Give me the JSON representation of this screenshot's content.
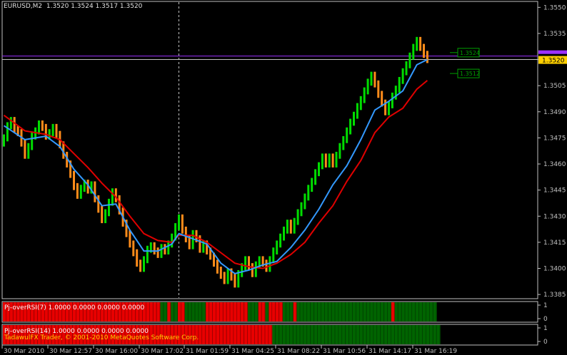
{
  "header": {
    "symbol_text": "EURUSD,M2",
    "ohlc_text": "1.3520 1.3524 1.3517 1.3520"
  },
  "colors": {
    "background": "#000000",
    "frame": "#c0c0c0",
    "bull": "#00dd00",
    "bear": "#ff8c1a",
    "ma_fast": "#3399ff",
    "ma_slow": "#e00000",
    "bid_line": "#9b30ff",
    "ask_box": "#ffd000",
    "indicator_red": "#e80000",
    "indicator_green": "#006400",
    "level_box": "#00a000"
  },
  "chart_data": [
    {
      "type": "candlestick",
      "name": "EURUSD,M2",
      "ylim": [
        1.3383,
        1.3553
      ],
      "y_ticks": [
        "1.3550",
        "1.3535",
        "1.3520",
        "1.3505",
        "1.3490",
        "1.3475",
        "1.3460",
        "1.3445",
        "1.3430",
        "1.3415",
        "1.3400",
        "1.3385"
      ],
      "x_ticks": [
        "30 Mar 2010",
        "30 Mar 12:57",
        "30 Mar 16:00",
        "30 Mar 17:02",
        "31 Mar 01:59",
        "31 Mar 04:25",
        "31 Mar 08:22",
        "31 Mar 10:56",
        "31 Mar 14:17",
        "31 Mar 16:19"
      ],
      "close": [
        1.3475,
        1.3482,
        1.3485,
        1.348,
        1.3478,
        1.3472,
        1.3465,
        1.347,
        1.3476,
        1.3479,
        1.3483,
        1.3481,
        1.3476,
        1.3478,
        1.3481,
        1.3477,
        1.3471,
        1.3465,
        1.346,
        1.3454,
        1.3447,
        1.3442,
        1.3446,
        1.3449,
        1.3445,
        1.3448,
        1.344,
        1.3434,
        1.3428,
        1.3432,
        1.3438,
        1.3444,
        1.344,
        1.3433,
        1.3426,
        1.342,
        1.3414,
        1.3409,
        1.3403,
        1.34,
        1.3405,
        1.3411,
        1.3413,
        1.341,
        1.3408,
        1.3412,
        1.341,
        1.3414,
        1.3418,
        1.3424,
        1.3429,
        1.3422,
        1.3417,
        1.3413,
        1.342,
        1.3417,
        1.3411,
        1.3414,
        1.341,
        1.3407,
        1.3403,
        1.3399,
        1.3396,
        1.3393,
        1.3398,
        1.3395,
        1.3391,
        1.3397,
        1.3401,
        1.3405,
        1.3401,
        1.3397,
        1.3402,
        1.3405,
        1.3403,
        1.34,
        1.3405,
        1.341,
        1.3414,
        1.3418,
        1.3422,
        1.3426,
        1.3422,
        1.3427,
        1.3432,
        1.3436,
        1.3441,
        1.3446,
        1.345,
        1.3455,
        1.3459,
        1.3464,
        1.346,
        1.3464,
        1.346,
        1.3465,
        1.347,
        1.3474,
        1.3479,
        1.3484,
        1.3488,
        1.3493,
        1.3497,
        1.3502,
        1.3507,
        1.3511,
        1.3506,
        1.35,
        1.3495,
        1.349,
        1.3494,
        1.3499,
        1.3503,
        1.3508,
        1.3513,
        1.3517,
        1.3522,
        1.3527,
        1.3531,
        1.3527,
        1.3523,
        1.352
      ],
      "ma_fast": {
        "x": [
          0,
          6,
          12,
          16,
          20,
          24,
          28,
          32,
          36,
          40,
          44,
          48,
          50,
          54,
          58,
          62,
          66,
          70,
          74,
          78,
          82,
          86,
          90,
          94,
          98,
          102,
          106,
          110,
          114,
          118,
          121
        ],
        "y": [
          1.3482,
          1.3474,
          1.3476,
          1.347,
          1.3457,
          1.3448,
          1.3436,
          1.3437,
          1.3422,
          1.341,
          1.341,
          1.3414,
          1.342,
          1.3417,
          1.3414,
          1.3403,
          1.3397,
          1.3399,
          1.3402,
          1.3404,
          1.3412,
          1.3422,
          1.3434,
          1.3448,
          1.3459,
          1.3474,
          1.3491,
          1.3496,
          1.3502,
          1.3517,
          1.352
        ]
      },
      "ma_slow": {
        "x": [
          0,
          6,
          12,
          16,
          20,
          24,
          28,
          32,
          36,
          40,
          44,
          48,
          50,
          54,
          58,
          62,
          66,
          70,
          74,
          78,
          82,
          86,
          90,
          94,
          98,
          102,
          106,
          110,
          114,
          118,
          121
        ],
        "y": [
          1.3488,
          1.3479,
          1.3477,
          1.3474,
          1.3466,
          1.3458,
          1.3449,
          1.3441,
          1.343,
          1.342,
          1.3416,
          1.3415,
          1.3419,
          1.3419,
          1.3415,
          1.3409,
          1.3403,
          1.3401,
          1.34,
          1.3403,
          1.3408,
          1.3415,
          1.3426,
          1.3436,
          1.345,
          1.3462,
          1.3478,
          1.3487,
          1.3492,
          1.3503,
          1.3508
        ]
      },
      "price_labels": [
        {
          "value": 1.3524,
          "text": "1.3524"
        },
        {
          "value": 1.3512,
          "text": "1.3512"
        }
      ],
      "bid_price": 1.352,
      "bid_label": "1.3520",
      "ask_price": 1.3522,
      "cursor_x": 50
    },
    {
      "type": "heatmap",
      "name": "Pj-overRSI(7)",
      "label": "Pj-overRSI(7) 1.0000 0.0000 0.0000 0.0000",
      "y_ticks": [
        "1",
        "0"
      ],
      "states": "RRRRRRRRRRRRRRRRRRRRRRRRRRRRRRRRRRRRRRRRRRRRRGGRGGRRGGGGGGRRRRRRRRRRRRGGGRRGRRRRGGGRGGGGGGGGGGGGGGGGGGGGGGGGGGGRGGGGGGGGGGGG"
    },
    {
      "type": "heatmap",
      "name": "Pj-overRSI(14)",
      "label": "Pj-overRSI(14) 1.0000 0.0000 0.0000 0.0000",
      "footer": "TadawulFX Trader, © 2001-2010 MetaQuotes Software Corp.",
      "y_ticks": [
        "1",
        "0"
      ],
      "states": "RRRRRRRRRRRRRRRRRRRRRRRRRRRRRRRRRRRRRRRRRRRRRRRRRRRRRRRRRRRRRRRRRRRRRRRRRRRRRGGGGGGGGGGGGGGGGGGGGGGGGGGGGGGGGGGGGGGGGGGGGGGGG"
    }
  ]
}
